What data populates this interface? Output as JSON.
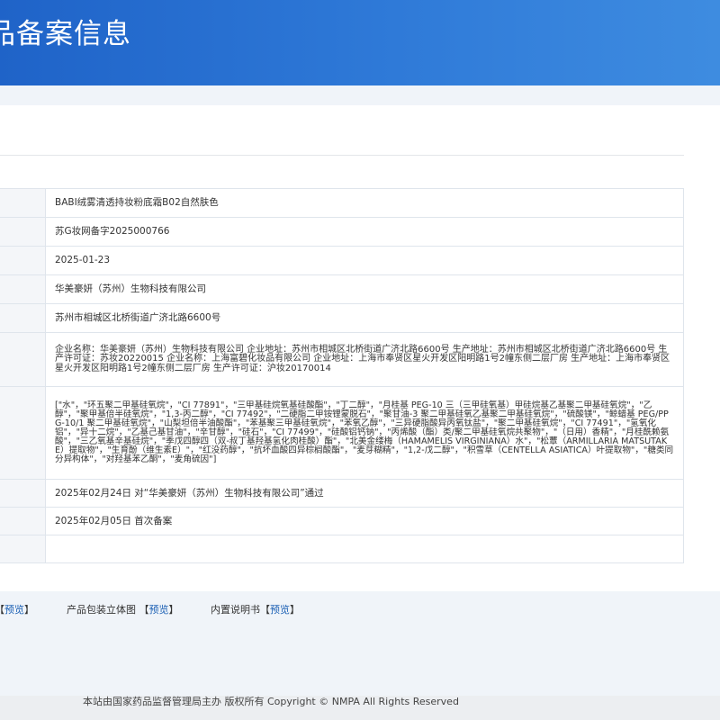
{
  "header": {
    "title": "品备案信息"
  },
  "rows": [
    "BABI绒雾清透持妆粉底霜B02自然肤色",
    "苏G妆网备字2025000766",
    "2025-01-23",
    "华美豪妍（苏州）生物科技有限公司",
    "苏州市相城区北桥街道广济北路6600号",
    "企业名称：华美豪妍（苏州）生物科技有限公司 企业地址：苏州市相城区北桥街道广济北路6600号 生产地址：苏州市相城区北桥街道广济北路6600号 生产许可证：苏妆20220015 企业名称：上海富碧化妆品有限公司 企业地址：上海市奉贤区星火开发区阳明路1号2幢东侧二层厂房 生产地址：上海市奉贤区星火开发区阳明路1号2幢东侧二层厂房 生产许可证：沪妆20170014",
    "[\"水\"，\"环五聚二甲基硅氧烷\"，\"CI 77891\"，\"三甲基硅烷氧基硅酸酯\"，\"丁二醇\"，\"月桂基 PEG-10 三（三甲硅氧基）甲硅烷基乙基聚二甲基硅氧烷\"，\"乙醇\"，\"聚甲基倍半硅氧烷\"，\"1,3-丙二醇\"，\"CI 77492\"，\"二硬脂二甲铵锂蒙脱石\"，\"聚甘油-3 聚二甲基硅氧乙基聚二甲基硅氧烷\"，\"硫酸镁\"，\"鲸蜡基 PEG/PPG-10/1 聚二甲基硅氧烷\"，\"山梨坦倍半油酸酯\"，\"苯基聚三甲基硅氧烷\"，\"苯氧乙醇\"，\"三异硬脂酸异丙氧钛盐\"，\"聚二甲基硅氧烷\"，\"CI 77491\"，\"氢氧化铝\"，\"异十二烷\"，\"乙基己基甘油\"，\"辛甘醇\"，\"硅石\"，\"CI 77499\"，\"硅酸铝钙钠\"，\"丙烯酸（酯）类/聚二甲基硅氧烷共聚物\"，\"（日用）香精\"，\"月桂酰赖氨酸\"，\"三乙氧基辛基硅烷\"，\"季戊四醇四（双-叔丁基羟基氢化肉桂酸）酯\"，\"北美金缕梅（HAMAMELIS VIRGINIANA）水\"，\"松蕈（ARMILLARIA MATSUTAKE）提取物\"，\"生育酚（维生素E）\"，\"红没药醇\"，\"抗坏血酸四异棕榈酸酯\"，\"麦芽糊精\"，\"1,2-戊二醇\"，\"积雪草（CENTELLA ASIATICA）叶提取物\"，\"糖类同分异构体\"，\"对羟基苯乙酮\"，\"麦角硫因\"]",
    "2025年02月24日 对“华美豪妍（苏州）生物科技有限公司”通过",
    "2025年02月05日 首次备案",
    ""
  ],
  "links": {
    "first_preview": "预览",
    "packaging_label": "产品包装立体图",
    "packaging_preview": "预览",
    "manual_label": "内置说明书",
    "manual_preview": "预览"
  },
  "footer": {
    "text": "本站由国家药品监督管理局主办 版权所有 Copyright © NMPA All Rights Reserved"
  }
}
